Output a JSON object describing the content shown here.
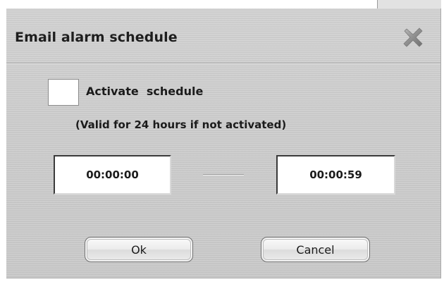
{
  "dialog": {
    "title": "Email alarm schedule",
    "close_icon": "close-icon"
  },
  "schedule": {
    "checkbox_label": "Activate  schedule",
    "checked": false,
    "note": "(Valid for 24 hours if not activated)",
    "start_time": "00:00:00",
    "end_time": "00:00:59"
  },
  "buttons": {
    "ok_label": "Ok",
    "cancel_label": "Cancel"
  },
  "colors": {
    "dialog_background": "#cbcbcb",
    "title_text": "#1e1e1e",
    "field_background": "#ffffff",
    "close_icon": "#8c8c8c"
  }
}
